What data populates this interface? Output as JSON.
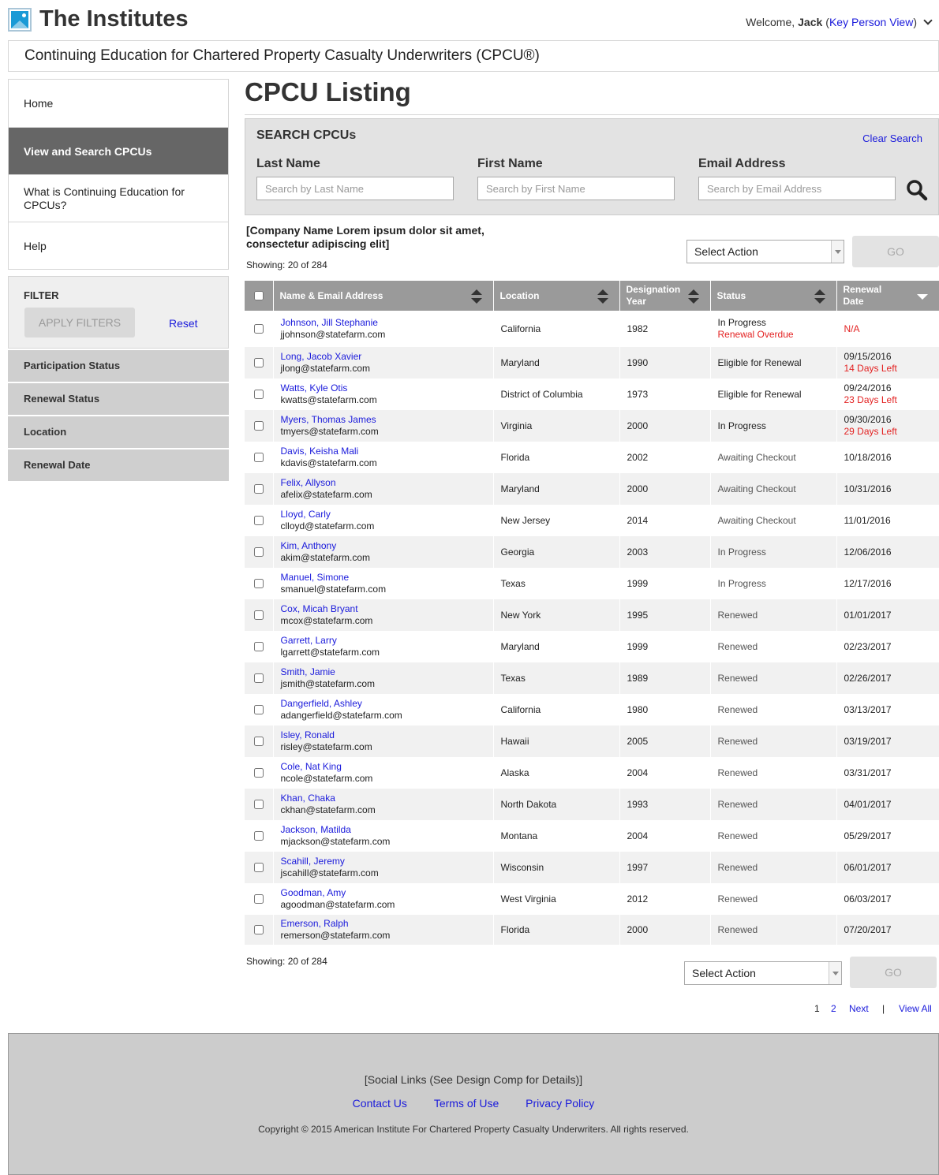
{
  "header": {
    "brand": "The Institutes",
    "welcome_prefix": "Welcome,",
    "user_name": "Jack",
    "open_paren": "(",
    "view_link": "Key Person View",
    "close_paren": ")"
  },
  "subtitle": "Continuing Education for Chartered Property Casualty Underwriters (CPCU®)",
  "sidebar": {
    "items": [
      {
        "label": "Home"
      },
      {
        "label": "View and Search CPCUs"
      },
      {
        "label": "What is Continuing Education for CPCUs?"
      },
      {
        "label": "Help"
      }
    ]
  },
  "filter": {
    "title": "FILTER",
    "apply_label": "APPLY FILTERS",
    "reset_label": "Reset",
    "sections": [
      "Participation Status",
      "Renewal Status",
      "Location",
      "Renewal Date"
    ]
  },
  "main": {
    "title": "CPCU Listing",
    "search": {
      "title": "SEARCH CPCUs",
      "clear_label": "Clear Search",
      "last_name_label": "Last Name",
      "last_name_placeholder": "Search by Last Name",
      "first_name_label": "First Name",
      "first_name_placeholder": "Search by First Name",
      "email_label": "Email Address",
      "email_placeholder": "Search by Email Address"
    },
    "company_name": "[Company Name Lorem ipsum dolor sit amet, consectetur adipiscing elit]",
    "showing": "Showing: 20 of 284",
    "select_action": "Select Action",
    "go_label": "GO"
  },
  "table": {
    "columns": {
      "name": "Name & Email Address",
      "location": "Location",
      "designation_year": "Designation Year",
      "status": "Status",
      "renewal_date": "Renewal Date"
    },
    "rows": [
      {
        "name": "Johnson, Jill Stephanie",
        "email": "jjohnson@statefarm.com",
        "location": "California",
        "year": "1982",
        "status": "In Progress",
        "status_note": "Renewal Overdue",
        "date": "N/A",
        "date_note": ""
      },
      {
        "name": "Long, Jacob Xavier",
        "email": "jlong@statefarm.com",
        "location": "Maryland",
        "year": "1990",
        "status": "Eligible for Renewal",
        "status_note": "",
        "date": "09/15/2016",
        "date_note": "14 Days Left"
      },
      {
        "name": "Watts, Kyle Otis",
        "email": "kwatts@statefarm.com",
        "location": "District of Columbia",
        "year": "1973",
        "status": "Eligible for Renewal",
        "status_note": "",
        "date": "09/24/2016",
        "date_note": "23 Days Left"
      },
      {
        "name": "Myers, Thomas James",
        "email": "tmyers@statefarm.com",
        "location": "Virginia",
        "year": "2000",
        "status": "In Progress",
        "status_note": "",
        "date": "09/30/2016",
        "date_note": "29 Days Left"
      },
      {
        "name": "Davis, Keisha Mali",
        "email": "kdavis@statefarm.com",
        "location": "Florida",
        "year": "2002",
        "status": "Awaiting Checkout",
        "status_note": "",
        "date": "10/18/2016",
        "date_note": ""
      },
      {
        "name": "Felix, Allyson",
        "email": "afelix@statefarm.com",
        "location": "Maryland",
        "year": "2000",
        "status": "Awaiting Checkout",
        "status_note": "",
        "date": "10/31/2016",
        "date_note": ""
      },
      {
        "name": "Lloyd, Carly",
        "email": "clloyd@statefarm.com",
        "location": "New Jersey",
        "year": "2014",
        "status": "Awaiting Checkout",
        "status_note": "",
        "date": "11/01/2016",
        "date_note": ""
      },
      {
        "name": "Kim, Anthony",
        "email": "akim@statefarm.com",
        "location": "Georgia",
        "year": "2003",
        "status": "In Progress",
        "status_note": "",
        "date": "12/06/2016",
        "date_note": ""
      },
      {
        "name": "Manuel, Simone",
        "email": "smanuel@statefarm.com",
        "location": "Texas",
        "year": "1999",
        "status": "In Progress",
        "status_note": "",
        "date": "12/17/2016",
        "date_note": ""
      },
      {
        "name": "Cox, Micah Bryant",
        "email": "mcox@statefarm.com",
        "location": "New York",
        "year": "1995",
        "status": "Renewed",
        "status_note": "",
        "date": "01/01/2017",
        "date_note": ""
      },
      {
        "name": "Garrett, Larry",
        "email": "lgarrett@statefarm.com",
        "location": "Maryland",
        "year": "1999",
        "status": "Renewed",
        "status_note": "",
        "date": "02/23/2017",
        "date_note": ""
      },
      {
        "name": "Smith, Jamie",
        "email": "jsmith@statefarm.com",
        "location": "Texas",
        "year": "1989",
        "status": "Renewed",
        "status_note": "",
        "date": "02/26/2017",
        "date_note": ""
      },
      {
        "name": "Dangerfield, Ashley",
        "email": "adangerfield@statefarm.com",
        "location": "California",
        "year": "1980",
        "status": "Renewed",
        "status_note": "",
        "date": "03/13/2017",
        "date_note": ""
      },
      {
        "name": "Isley, Ronald",
        "email": "risley@statefarm.com",
        "location": "Hawaii",
        "year": "2005",
        "status": "Renewed",
        "status_note": "",
        "date": "03/19/2017",
        "date_note": ""
      },
      {
        "name": "Cole, Nat King",
        "email": "ncole@statefarm.com",
        "location": "Alaska",
        "year": "2004",
        "status": "Renewed",
        "status_note": "",
        "date": "03/31/2017",
        "date_note": ""
      },
      {
        "name": "Khan, Chaka",
        "email": "ckhan@statefarm.com",
        "location": "North Dakota",
        "year": "1993",
        "status": "Renewed",
        "status_note": "",
        "date": "04/01/2017",
        "date_note": ""
      },
      {
        "name": "Jackson, Matilda",
        "email": "mjackson@statefarm.com",
        "location": "Montana",
        "year": "2004",
        "status": "Renewed",
        "status_note": "",
        "date": "05/29/2017",
        "date_note": ""
      },
      {
        "name": "Scahill, Jeremy",
        "email": "jscahill@statefarm.com",
        "location": "Wisconsin",
        "year": "1997",
        "status": "Renewed",
        "status_note": "",
        "date": "06/01/2017",
        "date_note": ""
      },
      {
        "name": "Goodman, Amy",
        "email": "agoodman@statefarm.com",
        "location": "West Virginia",
        "year": "2012",
        "status": "Renewed",
        "status_note": "",
        "date": "06/03/2017",
        "date_note": ""
      },
      {
        "name": "Emerson, Ralph",
        "email": "remerson@statefarm.com",
        "location": "Florida",
        "year": "2000",
        "status": "Renewed",
        "status_note": "",
        "date": "07/20/2017",
        "date_note": ""
      }
    ]
  },
  "pagination": {
    "page1": "1",
    "page2": "2",
    "next": "Next",
    "separator": "|",
    "view_all": "View All"
  },
  "footer": {
    "social": "[Social Links (See Design Comp for Details)]",
    "contact": "Contact Us",
    "terms": "Terms of Use",
    "privacy": "Privacy Policy",
    "copyright": "Copyright © 2015 American Institute For Chartered Property Casualty Underwriters. All rights reserved."
  },
  "colors": {
    "link": "#1a1adb",
    "alert": "#e32222",
    "nav_active": "#666666",
    "table_header": "#9a9a9a",
    "brand_icon": "#1a9ad6"
  }
}
